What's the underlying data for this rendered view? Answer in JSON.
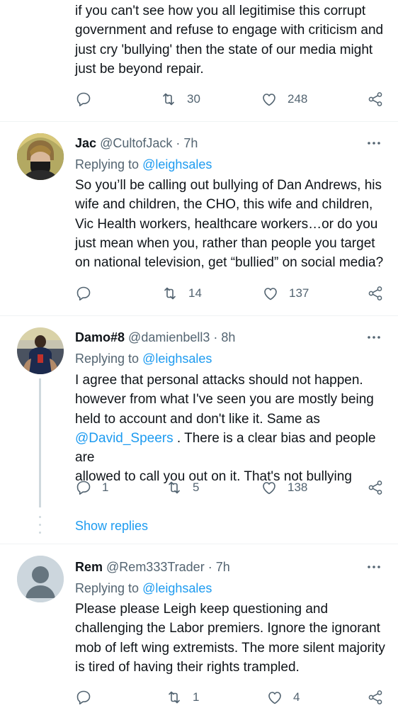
{
  "tweet0": {
    "lines": [
      "if you can't see how you all legitimise this corrupt",
      "government and refuse to engage with criticism and",
      "just cry 'bullying' then the state of our media might",
      "just be beyond repair."
    ],
    "retweets": "30",
    "likes": "248"
  },
  "tweet1": {
    "name": "Jac",
    "handle": "@CultofJack",
    "sep": "·",
    "time": "7h",
    "replying_prefix": "Replying to",
    "replying_to": "@leighsales",
    "lines": [
      "So you’ll be calling out bullying of Dan Andrews, his",
      "wife and children, the CHO, this wife and children,",
      "Vic Health workers, healthcare workers…or do you",
      "just mean when you, rather than people you target",
      "on national television, get “bullied” on social media?"
    ],
    "retweets": "14",
    "likes": "137"
  },
  "tweet2": {
    "name": "Damo#8",
    "handle": "@damienbell3",
    "sep": "·",
    "time": "8h",
    "replying_prefix": "Replying to",
    "replying_to": "@leighsales",
    "lines": [
      "I agree that personal attacks should not happen.",
      "however from what I've seen you are mostly being",
      "held to account and don't like it. Same as"
    ],
    "mention": "@David_Speers",
    "line4_rest": " . There is a clear bias and people are",
    "line5": "allowed to call you out on it. That's not bullying",
    "replies": "1",
    "retweets": "5",
    "likes": "138",
    "show_replies": "Show replies"
  },
  "tweet3": {
    "name": "Rem",
    "handle": "@Rem333Trader",
    "sep": "·",
    "time": "7h",
    "replying_prefix": "Replying to",
    "replying_to": "@leighsales",
    "lines": [
      "Please please Leigh keep questioning and",
      "challenging the Labor premiers. Ignore the ignorant",
      "mob of left wing extremists. The more silent majority",
      "is tired of having their rights trampled."
    ],
    "retweets": "1",
    "likes": "4"
  },
  "icons": {
    "reply": "reply-icon",
    "retweet": "retweet-icon",
    "like": "heart-icon",
    "share": "share-icon",
    "more": "more-icon"
  },
  "colors": {
    "text": "#0f1419",
    "secondary": "#536471",
    "link": "#1d9bf0",
    "divider": "#eff3f4"
  }
}
